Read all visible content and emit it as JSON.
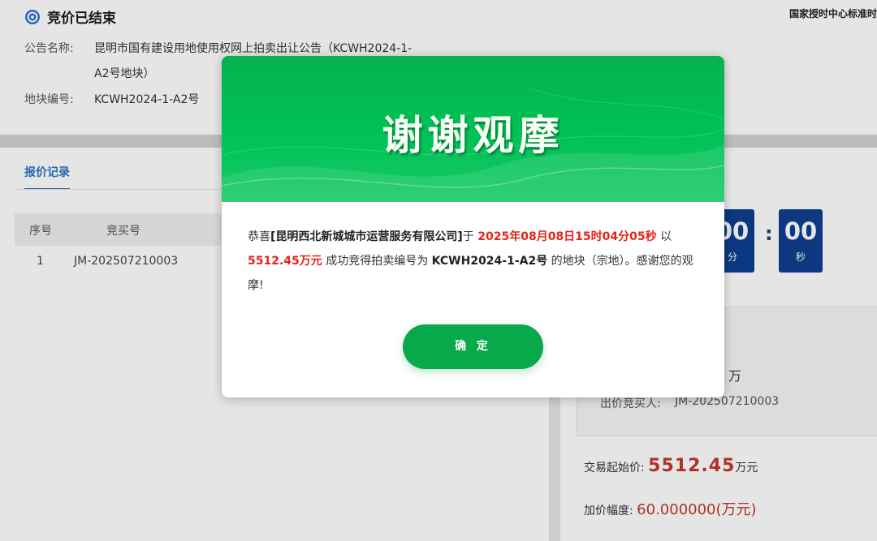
{
  "header": {
    "status": "竞价已结束",
    "org": "国家授时中心标准时",
    "notice_label": "公告名称:",
    "notice_line1": "昆明市国有建设用地使用权网上拍卖出让公告（KCWH2024-1-",
    "notice_line2": "A2号地块）",
    "parcel_label": "地块编号:",
    "parcel_value": "KCWH2024-1-A2号"
  },
  "records": {
    "tab_label": "报价记录",
    "columns": [
      "序号",
      "竞买号"
    ],
    "rows": [
      {
        "index": "1",
        "bidder": "JM-202507210003"
      }
    ]
  },
  "timer": {
    "minutes": "00",
    "minutes_unit": "分",
    "seconds": "00",
    "seconds_unit": "秒"
  },
  "result": {
    "unit": "万",
    "winner_label": "出价竞买人:",
    "winner_value": "JM-202507210003"
  },
  "pricing": {
    "start_label": "交易起始价:",
    "start_value": "5512.45",
    "start_unit": "万元",
    "step_label": "加价幅度:",
    "step_value": "60.000000(万元)"
  },
  "modal": {
    "banner_title": "谢谢观摩",
    "t1": "恭喜",
    "company": "[昆明西北新城城市运营服务有限公司]",
    "t2": "于 ",
    "time": "2025年08月08日15时04分05秒",
    "t3": " 以 ",
    "price": "5512.45万元",
    "t4": " 成功竞得拍卖编号为 ",
    "code": "KCWH2024-1-A2号",
    "t5": " 的地块（宗地）。感谢您的观摩!",
    "ok_label": "确 定"
  },
  "colors": {
    "accent_blue": "#2a73c8",
    "timer_blue": "#0d3f8f",
    "banner_green": "#00c256",
    "button_green": "#07a94a",
    "highlight_red": "#e0261b"
  }
}
